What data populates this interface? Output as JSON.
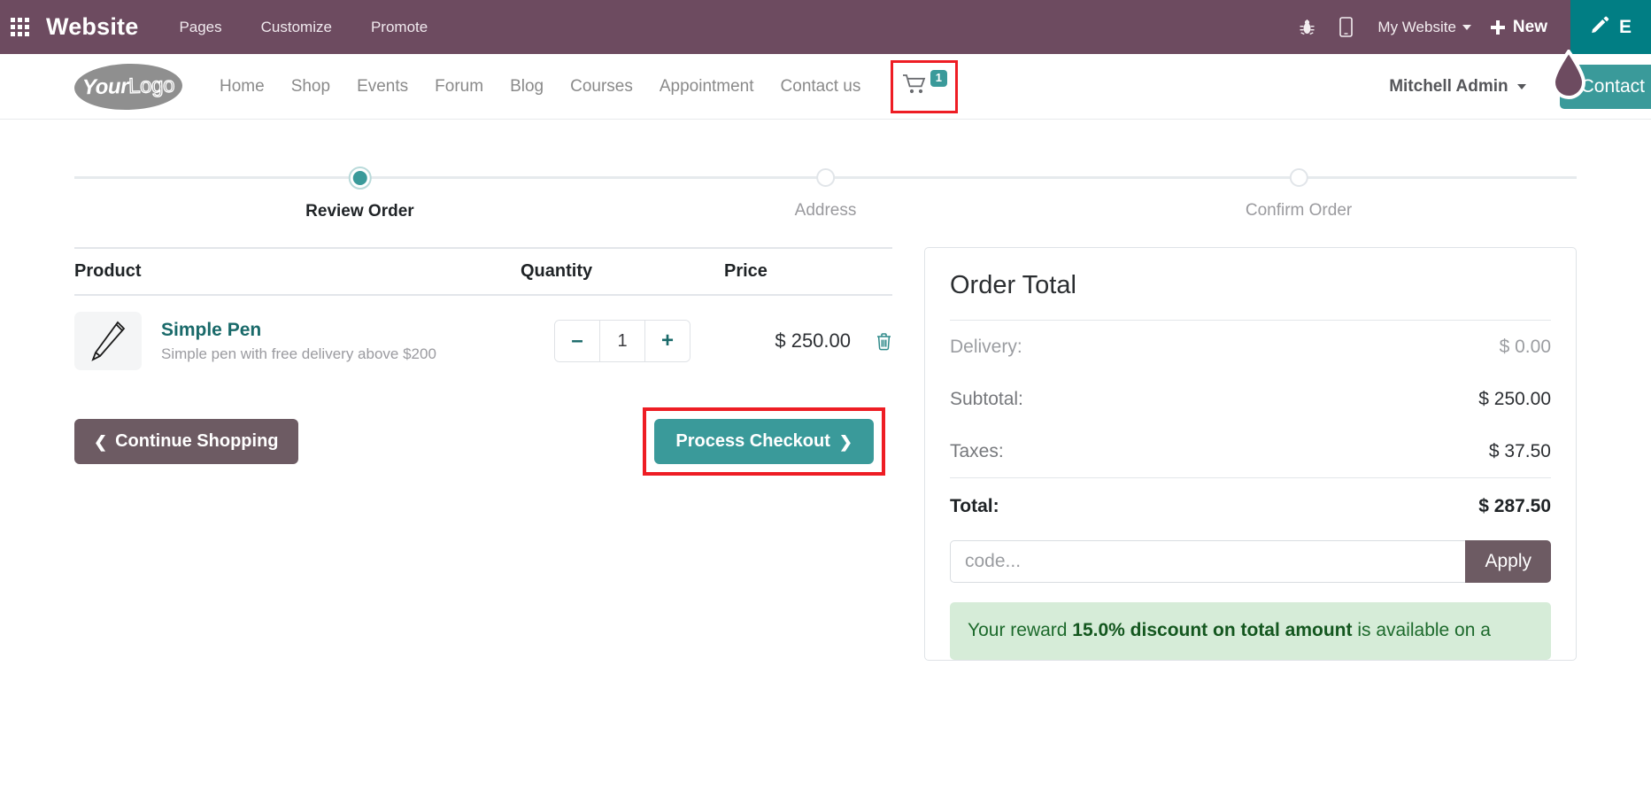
{
  "backend_bar": {
    "apps_icon": "apps-grid-icon",
    "app_title": "Website",
    "menu": [
      {
        "label": "Pages"
      },
      {
        "label": "Customize"
      },
      {
        "label": "Promote"
      }
    ],
    "bug_icon": "bug-icon",
    "mobile_icon": "mobile-preview-icon",
    "website_selector": "My Website",
    "new_label": "New",
    "edit_label": "E",
    "bar_color": "#6d4b60",
    "edit_color": "#017e84"
  },
  "site_header": {
    "logo": {
      "part1": "Your",
      "part2": "Logo"
    },
    "nav": [
      {
        "label": "Home"
      },
      {
        "label": "Shop"
      },
      {
        "label": "Events"
      },
      {
        "label": "Forum"
      },
      {
        "label": "Blog"
      },
      {
        "label": "Courses"
      },
      {
        "label": "Appointment"
      },
      {
        "label": "Contact us"
      }
    ],
    "cart": {
      "icon": "shopping-cart-icon",
      "count": "1",
      "badge_color": "#3a9a9a"
    },
    "user": "Mitchell Admin",
    "contact_button": "Contact U",
    "accent_color": "#3a9a9a"
  },
  "checkout": {
    "steps": [
      {
        "label": "Review Order",
        "active": true
      },
      {
        "label": "Address",
        "active": false
      },
      {
        "label": "Confirm Order",
        "active": false
      }
    ],
    "table": {
      "headers": {
        "product": "Product",
        "quantity": "Quantity",
        "price": "Price"
      },
      "rows": [
        {
          "image_icon": "pen-product-image",
          "name": "Simple Pen",
          "description": "Simple pen with free delivery above $200",
          "quantity": "1",
          "minus_label": "–",
          "plus_label": "+",
          "price": "$ 250.00",
          "delete_icon": "trash-icon"
        }
      ]
    },
    "continue_shopping": "Continue Shopping",
    "process_checkout": "Process Checkout"
  },
  "order_total": {
    "title": "Order Total",
    "rows": [
      {
        "label": "Delivery:",
        "value": "$ 0.00",
        "muted": true
      },
      {
        "label": "Subtotal:",
        "value": "$ 250.00",
        "muted": false
      },
      {
        "label": "Taxes:",
        "value": "$ 37.50",
        "muted": false
      }
    ],
    "grand": {
      "label": "Total:",
      "value": "$ 287.50"
    },
    "promo": {
      "placeholder": "code...",
      "value": "",
      "apply_label": "Apply"
    },
    "reward": {
      "prefix": "Your reward ",
      "highlight": "15.0% discount on total amount",
      "suffix": " is available on a"
    }
  }
}
